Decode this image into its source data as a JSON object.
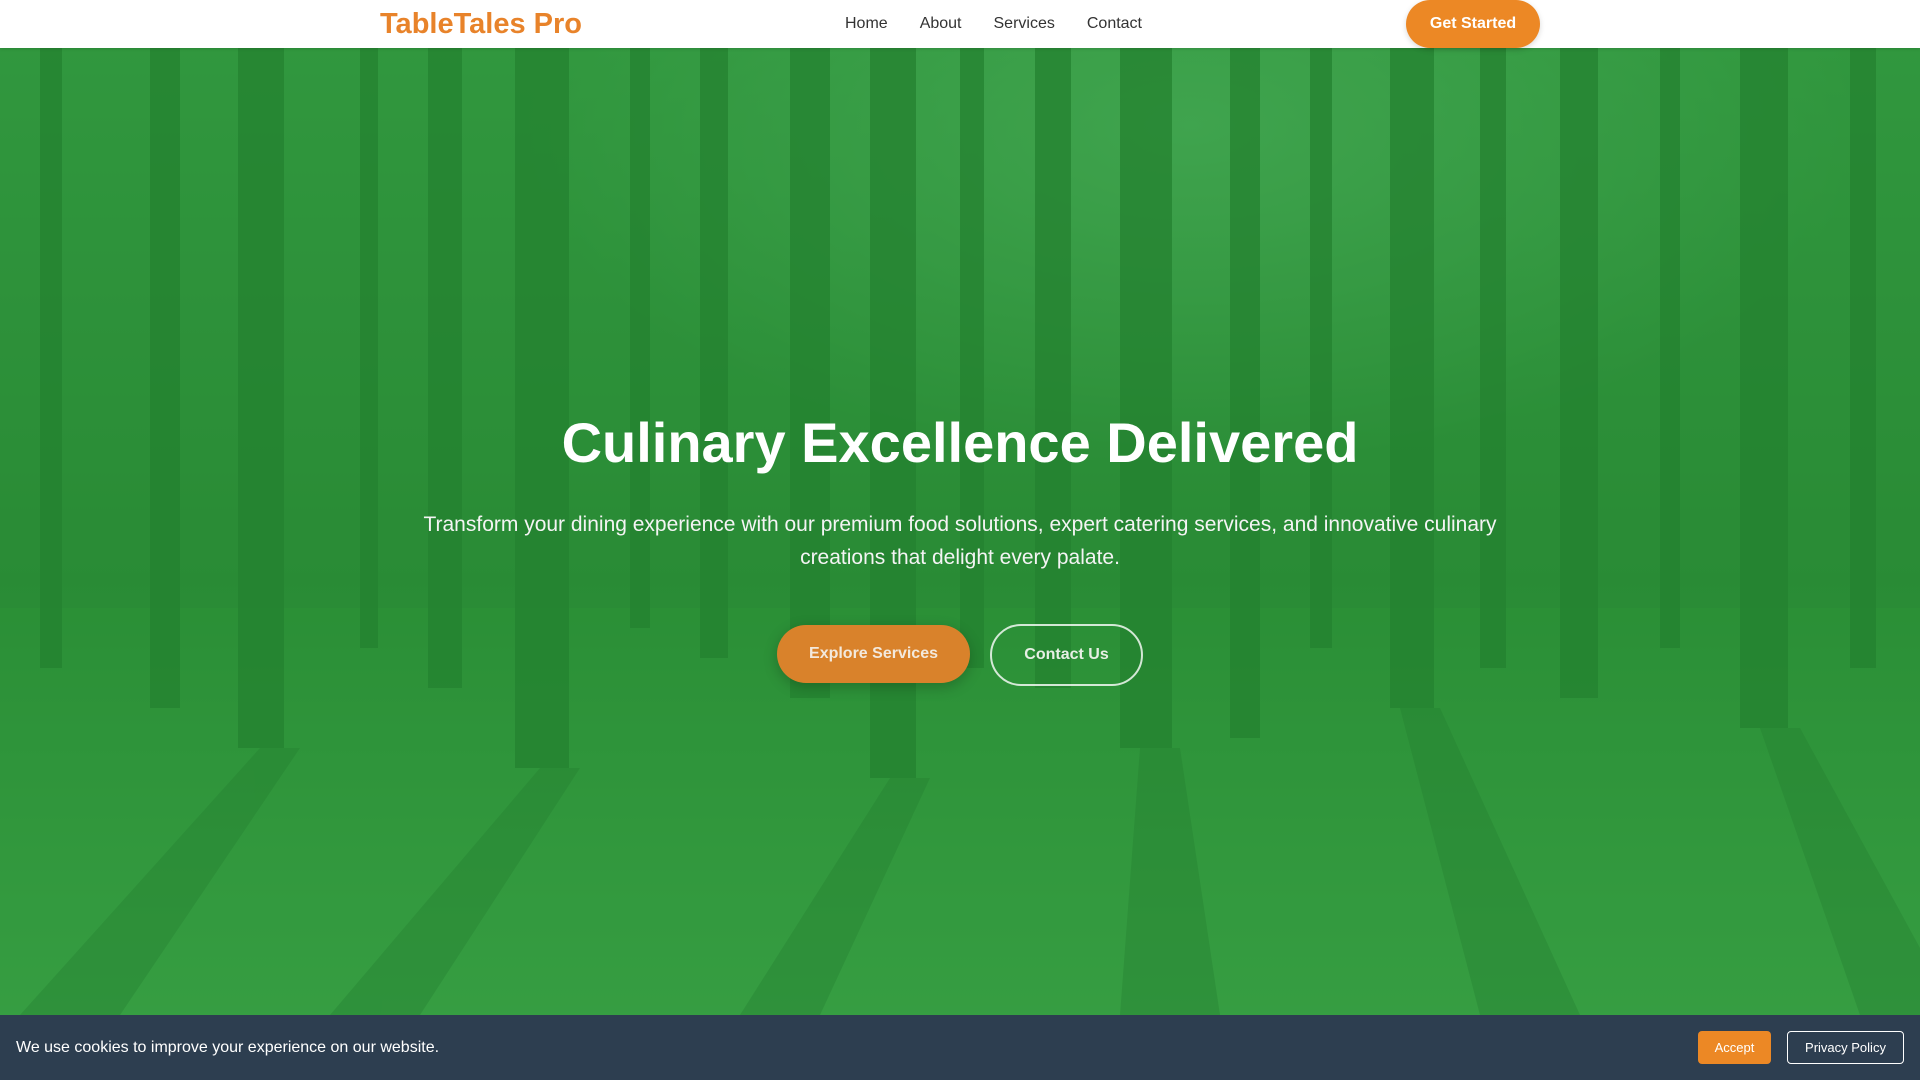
{
  "navbar": {
    "brand": "TableTales Pro",
    "links": [
      "Home",
      "About",
      "Services",
      "Contact"
    ],
    "cta_label": "Get Started"
  },
  "hero": {
    "title": "Culinary Excellence Delivered",
    "subtitle": "Transform your dining experience with our premium food solutions, expert catering services, and innovative culinary creations that delight every palate.",
    "primary_button": "Explore Services",
    "secondary_button": "Contact Us"
  },
  "cookie_bar": {
    "message": "We use cookies to improve your experience on our website.",
    "accept_label": "Accept",
    "privacy_label": "Privacy Policy"
  },
  "colors": {
    "brand": "#e8832a",
    "accent": "#ec8825",
    "hero_green": "#2f8f3a",
    "cookie_bg": "#2d3e50"
  }
}
